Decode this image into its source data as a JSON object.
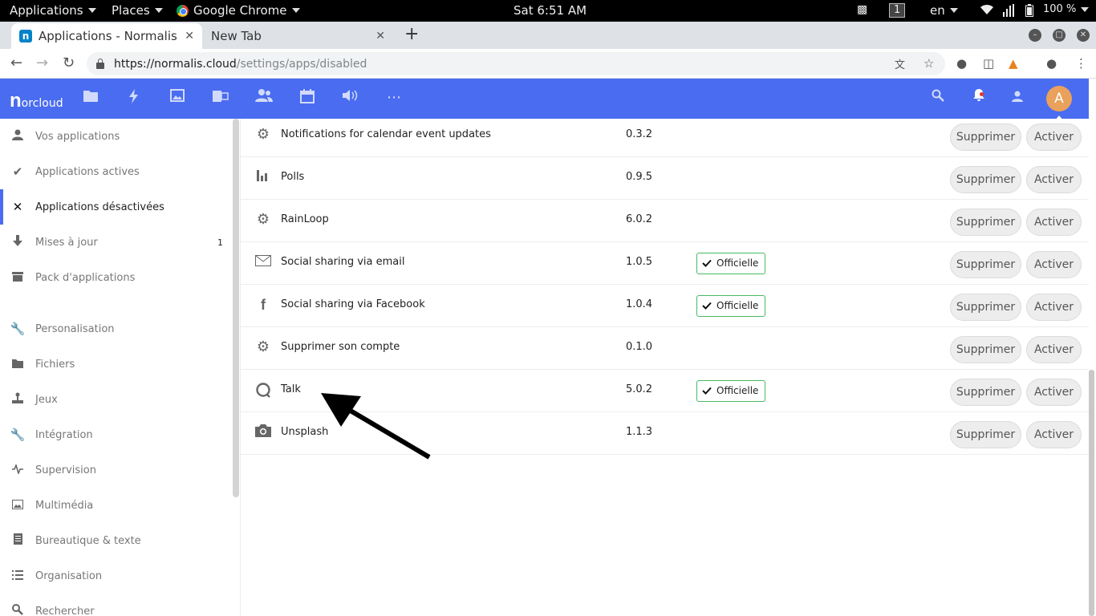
{
  "topbar": {
    "applications_menu": "Applications",
    "places_menu": "Places",
    "app_name": "Google Chrome",
    "clock": "Sat  6:51 AM",
    "workspace": "1",
    "language": "en",
    "battery": "100 %"
  },
  "browser": {
    "tabs": [
      {
        "label": "Applications - Normalis",
        "favicon": "nextcloud-icon"
      },
      {
        "label": "New Tab"
      }
    ],
    "new_tab_symbol": "+",
    "url_host": "https://normalis.cloud",
    "url_path": "/settings/apps/disabled"
  },
  "header": {
    "logo_letter": "n",
    "logo_text": "orcloud",
    "avatar_initial": "A",
    "accent_color": "#4a6cf0"
  },
  "sidebar": {
    "items": [
      {
        "label": "Vos applications",
        "icon": "user-icon"
      },
      {
        "label": "Applications actives",
        "icon": "checkmark-icon"
      },
      {
        "label": "Applications désactivées",
        "icon": "close-icon",
        "active": true
      },
      {
        "label": "Mises à jour",
        "icon": "download-icon",
        "count": "1"
      },
      {
        "label": "Pack d'applications",
        "icon": "archive-icon"
      },
      {
        "label": "Personalisation",
        "icon": "wrench-icon"
      },
      {
        "label": "Fichiers",
        "icon": "folder-icon"
      },
      {
        "label": "Jeux",
        "icon": "joystick-icon"
      },
      {
        "label": "Intégration",
        "icon": "wrench-icon"
      },
      {
        "label": "Supervision",
        "icon": "activity-icon"
      },
      {
        "label": "Multimédia",
        "icon": "image-icon"
      },
      {
        "label": "Bureautique & texte",
        "icon": "document-icon"
      },
      {
        "label": "Organisation",
        "icon": "list-icon"
      },
      {
        "label": "Rechercher",
        "icon": "search-icon"
      }
    ]
  },
  "apps": {
    "delete_label": "Supprimer",
    "enable_label": "Activer",
    "official_label": "Officielle",
    "list": [
      {
        "name": "Notifications for calendar event updates",
        "version": "0.3.2",
        "icon": "gear-icon",
        "official": false
      },
      {
        "name": "Polls",
        "version": "0.9.5",
        "icon": "bar-chart-icon",
        "official": false
      },
      {
        "name": "RainLoop",
        "version": "6.0.2",
        "icon": "gear-icon",
        "official": false
      },
      {
        "name": "Social sharing via email",
        "version": "1.0.5",
        "icon": "mail-icon",
        "official": true
      },
      {
        "name": "Social sharing via Facebook",
        "version": "1.0.4",
        "icon": "facebook-icon",
        "official": true
      },
      {
        "name": "Supprimer son compte",
        "version": "0.1.0",
        "icon": "gear-icon",
        "official": false
      },
      {
        "name": "Talk",
        "version": "5.0.2",
        "icon": "talk-icon",
        "official": true
      },
      {
        "name": "Unsplash",
        "version": "1.1.3",
        "icon": "camera-icon",
        "official": false
      }
    ]
  }
}
